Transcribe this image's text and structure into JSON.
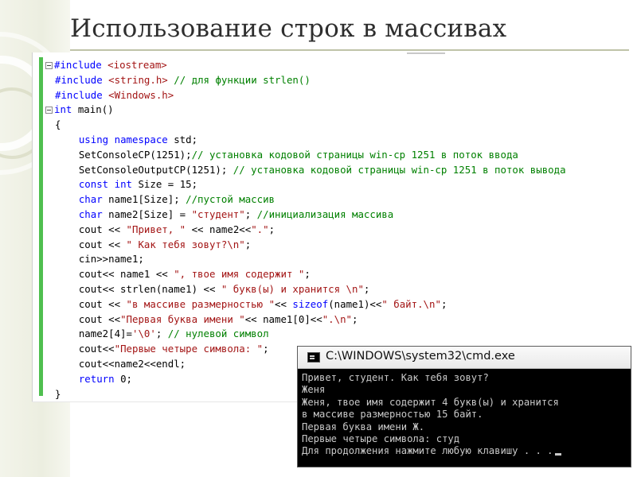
{
  "slide": {
    "title": "Использование строк в массивах"
  },
  "code": {
    "lines": [
      {
        "parts": [
          {
            "t": "#include",
            "c": "pp"
          },
          {
            "t": " "
          },
          {
            "t": "<iostream>",
            "c": "str"
          }
        ],
        "fold": true
      },
      {
        "parts": [
          {
            "t": "#include",
            "c": "pp"
          },
          {
            "t": " "
          },
          {
            "t": "<string.h>",
            "c": "str"
          },
          {
            "t": " "
          },
          {
            "t": "// для функции strlen()",
            "c": "cmt"
          }
        ]
      },
      {
        "parts": [
          {
            "t": "#include",
            "c": "pp"
          },
          {
            "t": " "
          },
          {
            "t": "<Windows.h>",
            "c": "str"
          }
        ]
      },
      {
        "parts": [
          {
            "t": "int",
            "c": "kw"
          },
          {
            "t": " main()"
          }
        ],
        "fold": true
      },
      {
        "parts": [
          {
            "t": "{"
          }
        ]
      },
      {
        "parts": [
          {
            "t": "    "
          },
          {
            "t": "using",
            "c": "kw"
          },
          {
            "t": " "
          },
          {
            "t": "namespace",
            "c": "kw"
          },
          {
            "t": " std;"
          }
        ]
      },
      {
        "parts": [
          {
            "t": "    SetConsoleCP(1251);"
          },
          {
            "t": "// установка кодовой страницы win-cp 1251 в поток ввода",
            "c": "cmt"
          }
        ]
      },
      {
        "parts": [
          {
            "t": "    SetConsoleOutputCP(1251); "
          },
          {
            "t": "// установка кодовой страницы win-cp 1251 в поток вывода",
            "c": "cmt"
          }
        ]
      },
      {
        "parts": [
          {
            "t": "    "
          },
          {
            "t": "const",
            "c": "kw"
          },
          {
            "t": " "
          },
          {
            "t": "int",
            "c": "kw"
          },
          {
            "t": " Size = 15;"
          }
        ]
      },
      {
        "parts": [
          {
            "t": "    "
          },
          {
            "t": "char",
            "c": "kw"
          },
          {
            "t": " name1[Size]; "
          },
          {
            "t": "//пустой массив",
            "c": "cmt"
          }
        ]
      },
      {
        "parts": [
          {
            "t": "    "
          },
          {
            "t": "char",
            "c": "kw"
          },
          {
            "t": " name2[Size] = "
          },
          {
            "t": "\"студент\"",
            "c": "str"
          },
          {
            "t": "; "
          },
          {
            "t": "//инициализация массива",
            "c": "cmt"
          }
        ]
      },
      {
        "parts": [
          {
            "t": "    cout << "
          },
          {
            "t": "\"Привет, \"",
            "c": "str"
          },
          {
            "t": " << name2<<"
          },
          {
            "t": "\".\"",
            "c": "str"
          },
          {
            "t": ";"
          }
        ]
      },
      {
        "parts": [
          {
            "t": "    cout << "
          },
          {
            "t": "\" Как тебя зовут?\\n\"",
            "c": "str"
          },
          {
            "t": ";"
          }
        ]
      },
      {
        "parts": [
          {
            "t": "    cin>>name1;"
          }
        ]
      },
      {
        "parts": [
          {
            "t": "    cout<< name1 << "
          },
          {
            "t": "\", твое имя содержит \"",
            "c": "str"
          },
          {
            "t": ";"
          }
        ]
      },
      {
        "parts": [
          {
            "t": "    cout<< strlen(name1) << "
          },
          {
            "t": "\" букв(ы) и хранится \\n\"",
            "c": "str"
          },
          {
            "t": ";"
          }
        ]
      },
      {
        "parts": [
          {
            "t": "    cout << "
          },
          {
            "t": "\"в массиве размерностью \"",
            "c": "str"
          },
          {
            "t": "<< "
          },
          {
            "t": "sizeof",
            "c": "kw"
          },
          {
            "t": "(name1)<<"
          },
          {
            "t": "\" байт.\\n\"",
            "c": "str"
          },
          {
            "t": ";"
          }
        ]
      },
      {
        "parts": [
          {
            "t": "    cout <<"
          },
          {
            "t": "\"Первая буква имени \"",
            "c": "str"
          },
          {
            "t": "<< name1[0]<<"
          },
          {
            "t": "\".\\n\"",
            "c": "str"
          },
          {
            "t": ";"
          }
        ]
      },
      {
        "parts": [
          {
            "t": "    name2[4]="
          },
          {
            "t": "'\\0'",
            "c": "str"
          },
          {
            "t": "; "
          },
          {
            "t": "// нулевой символ",
            "c": "cmt"
          }
        ]
      },
      {
        "parts": [
          {
            "t": "    cout<<"
          },
          {
            "t": "\"Первые четыре символа: \"",
            "c": "str"
          },
          {
            "t": ";"
          }
        ]
      },
      {
        "parts": [
          {
            "t": "    cout<<name2<<endl;"
          }
        ]
      },
      {
        "parts": [
          {
            "t": "    "
          },
          {
            "t": "return",
            "c": "kw"
          },
          {
            "t": " 0;"
          }
        ]
      },
      {
        "parts": [
          {
            "t": "}"
          }
        ]
      }
    ]
  },
  "console": {
    "title": "C:\\WINDOWS\\system32\\cmd.exe",
    "lines": [
      "Привет, студент. Как тебя зовут?",
      "Женя",
      "Женя, твое имя содержит 4 букв(ы) и хранится",
      "в массиве размерностью 15 байт.",
      "Первая буква имени Ж.",
      "Первые четыре символа: студ",
      "Для продолжения нажмите любую клавишу . . ."
    ]
  },
  "colors": {
    "keyword": "#0000ff",
    "string": "#a31515",
    "comment": "#008000",
    "console_text": "#c9c9c9",
    "console_bg": "#000000"
  }
}
